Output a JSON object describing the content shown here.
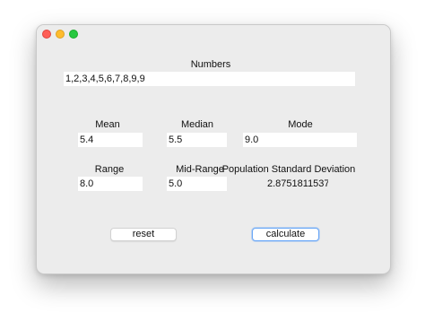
{
  "window": {
    "controls": {
      "close_color": "#fe5f57",
      "minimize_color": "#febc2e",
      "maximize_color": "#28c840"
    }
  },
  "numbers": {
    "label": "Numbers",
    "value": "1,2,3,4,5,6,7,8,9,9"
  },
  "stats": {
    "mean": {
      "label": "Mean",
      "value": "5.4"
    },
    "median": {
      "label": "Median",
      "value": "5.5"
    },
    "mode": {
      "label": "Mode",
      "value": "9.0"
    },
    "range": {
      "label": "Range",
      "value": "8.0"
    },
    "mid_range": {
      "label": "Mid-Range",
      "value": "5.0"
    },
    "population_std_dev": {
      "label": "Population Standard Deviation",
      "value": "2.8751811537"
    }
  },
  "buttons": {
    "reset_label": "reset",
    "calculate_label": "calculate"
  }
}
